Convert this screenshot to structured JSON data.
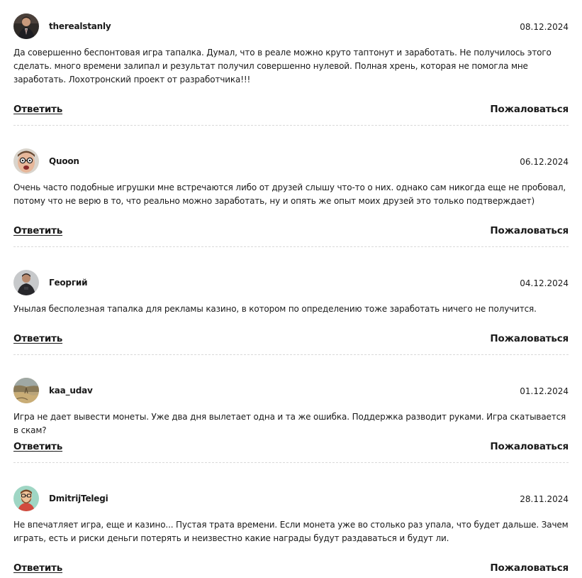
{
  "comments": [
    {
      "author": "therealstanly",
      "avatar": "avatar-man-in-suit",
      "date": "08.12.2024",
      "text": "Да совершенно беспонтовая игра тапалка. Думал, что в реале можно круто таптонут и заработать. Не получилось этого сделать. много времени залипал и результат получил совершенно нулевой. Полная хрень, которая не помогла мне заработать. Лохотронский проект от разработчика!!!",
      "reply_label": "Ответить",
      "report_label": "Пожаловаться"
    },
    {
      "author": "Quoon",
      "avatar": "avatar-face-glasses",
      "date": "06.12.2024",
      "text": "Очень часто подобные игрушки мне встречаются либо от друзей слышу что-то о них. однако сам никогда еще не пробовал, потому что не верю в то, что реально можно заработать, ну и опять же опыт моих друзей это только подтверждает)",
      "reply_label": "Ответить",
      "report_label": "Пожаловаться"
    },
    {
      "author": "Георгий",
      "avatar": "avatar-man-dark-shirt",
      "date": "04.12.2024",
      "text": "Унылая бесполезная тапалка для рекламы казино, в котором по определению тоже заработать ничего не получится.",
      "reply_label": "Ответить",
      "report_label": "Пожаловаться"
    },
    {
      "author": "kaa_udav",
      "avatar": "avatar-landscape",
      "date": "01.12.2024",
      "text": "Игра не дает вывести монеты. Уже два дня вылетает одна и та же ошибка. Поддержка разводит руками. Игра скатывается в скам?",
      "reply_label": "Ответить",
      "report_label": "Пожаловаться"
    },
    {
      "author": "DmitrijTelegi",
      "avatar": "avatar-cartoon-bearded",
      "date": "28.11.2024",
      "text": "Не впечатляет игра, еще и казино... Пустая трата времени. Если монета уже во столько раз упала, что будет дальше. Зачем играть, есть и риски деньги потерять и неизвестно какие награды будут раздаваться и будут ли.",
      "reply_label": "Ответить",
      "report_label": "Пожаловаться"
    }
  ]
}
